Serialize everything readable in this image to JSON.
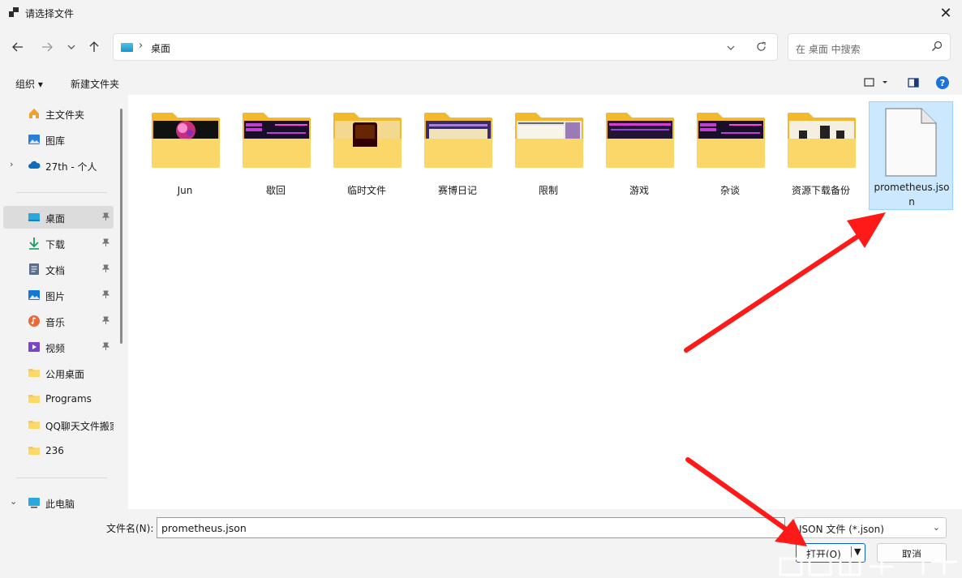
{
  "window": {
    "title": "请选择文件",
    "close": "✕"
  },
  "nav": {
    "back": "←",
    "forward": "→",
    "recent": "⌄",
    "up": "↑"
  },
  "address": {
    "separator": "›",
    "path": "桌面",
    "dropdown": "⌄",
    "refresh": "↻"
  },
  "search": {
    "placeholder": "在 桌面 中搜索"
  },
  "toolbar": {
    "organize": "组织 ▾",
    "new_folder": "新建文件夹",
    "view_dropdown": "▾",
    "help": "?"
  },
  "sidebar": {
    "items": [
      {
        "label": "主文件夹",
        "icon": "home-icon"
      },
      {
        "label": "图库",
        "icon": "gallery-icon"
      },
      {
        "label": "27th - 个人",
        "icon": "onedrive-cloud-icon",
        "expand": "›"
      },
      {
        "label": "桌面",
        "icon": "desktop-icon",
        "pinned": true,
        "selected": true
      },
      {
        "label": "下载",
        "icon": "download-icon",
        "pinned": true
      },
      {
        "label": "文档",
        "icon": "document-icon",
        "pinned": true
      },
      {
        "label": "图片",
        "icon": "pictures-icon",
        "pinned": true
      },
      {
        "label": "音乐",
        "icon": "music-icon",
        "pinned": true
      },
      {
        "label": "视频",
        "icon": "video-icon",
        "pinned": true
      },
      {
        "label": "公用桌面",
        "icon": "folder-icon"
      },
      {
        "label": "Programs",
        "icon": "folder-icon"
      },
      {
        "label": "QQ聊天文件搬家",
        "icon": "folder-icon"
      },
      {
        "label": "236",
        "icon": "folder-icon"
      },
      {
        "label": "此电脑",
        "icon": "this-pc-icon",
        "expand": "⌄"
      }
    ],
    "pin_glyph": "📌"
  },
  "files": [
    {
      "name": "Jun",
      "type": "folder",
      "preview": "pink-splash"
    },
    {
      "name": "歇回",
      "type": "folder",
      "preview": "studio-dark"
    },
    {
      "name": "临时文件",
      "type": "folder",
      "preview": "illustrator"
    },
    {
      "name": "赛博日记",
      "type": "folder",
      "preview": "purple-window"
    },
    {
      "name": "限制",
      "type": "folder",
      "preview": "light-window"
    },
    {
      "name": "游戏",
      "type": "folder",
      "preview": "dark-window"
    },
    {
      "name": "杂谈",
      "type": "folder",
      "preview": "studio-dark"
    },
    {
      "name": "资源下载备份",
      "type": "folder",
      "preview": "black-glyphs"
    },
    {
      "name": "prometheus.json",
      "type": "file",
      "selected": true
    }
  ],
  "bottom": {
    "filename_label": "文件名(N):",
    "filename_value": "prometheus.json",
    "filetype_value": "JSON 文件 (*.json)",
    "filetype_chevron": "⌄",
    "open_label": "打开(O)",
    "open_dropdown": "▼",
    "cancel_label": "取消"
  },
  "colors": {
    "accent": "#0b60c9",
    "annotation_arrow": "#ff1a1a",
    "selection": "#cce8ff",
    "folder": "#f9c845"
  }
}
